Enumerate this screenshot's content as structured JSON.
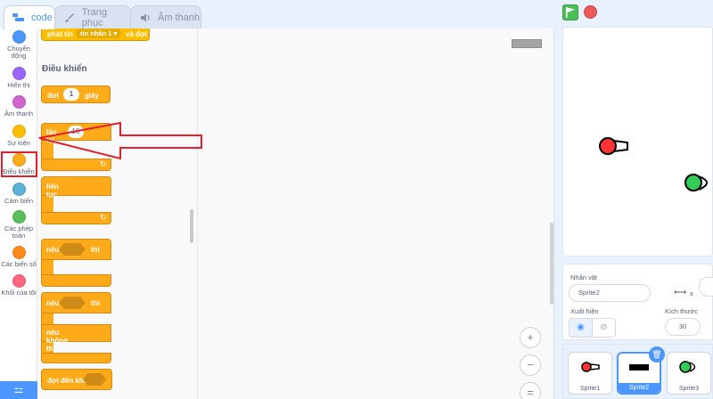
{
  "tabs": [
    {
      "label": "code",
      "icon": "code-icon",
      "active": true
    },
    {
      "label": "Trang phục",
      "icon": "brush-icon",
      "active": false
    },
    {
      "label": "Âm thanh",
      "icon": "speaker-icon",
      "active": false
    }
  ],
  "categories": [
    {
      "label": "Chuyển động",
      "color": "#4c97ff"
    },
    {
      "label": "Hiển thị",
      "color": "#9966ff"
    },
    {
      "label": "Âm thanh",
      "color": "#cf63cf"
    },
    {
      "label": "Sự kiện",
      "color": "#ffbf00"
    },
    {
      "label": "Điều khiển",
      "color": "#ffab19"
    },
    {
      "label": "Cảm biến",
      "color": "#5cb1d6"
    },
    {
      "label": "Các phép toán",
      "color": "#59c059"
    },
    {
      "label": "Các biến số",
      "color": "#ff8c1a"
    },
    {
      "label": "Khối của tôi",
      "color": "#ff6680"
    }
  ],
  "palette": {
    "top_block": {
      "prefix": "phát tin",
      "dropdown": "tin nhắn 1 ▾",
      "suffix": "và đợi"
    },
    "section_title": "Điều khiển",
    "wait": {
      "prefix": "đợi",
      "value": "1",
      "suffix": "giây"
    },
    "repeat": {
      "prefix": "lặp lại",
      "value": "10"
    },
    "forever": {
      "label": "liên tục"
    },
    "if_then": {
      "prefix": "nếu",
      "suffix": "thì"
    },
    "if_else": {
      "prefix": "nếu",
      "suffix": "thì",
      "else": "nếu không thì"
    },
    "wait_until": {
      "label": "đợi đến khi"
    }
  },
  "zoom": {
    "in": "+",
    "out": "−",
    "reset": "="
  },
  "sprite_info": {
    "name_label": "Nhân vật",
    "name_value": "Sprite2",
    "show_label": "Xuất hiện",
    "size_label": "Kích thước",
    "size_value": "30",
    "x_label": "x"
  },
  "sprites": [
    {
      "name": "Sprite1",
      "selected": false
    },
    {
      "name": "Sprite2",
      "selected": true
    },
    {
      "name": "Sprite3",
      "selected": false
    }
  ],
  "colors": {
    "highlight": "#e0202b",
    "accent": "#4c97ff",
    "control": "#ffab19"
  }
}
